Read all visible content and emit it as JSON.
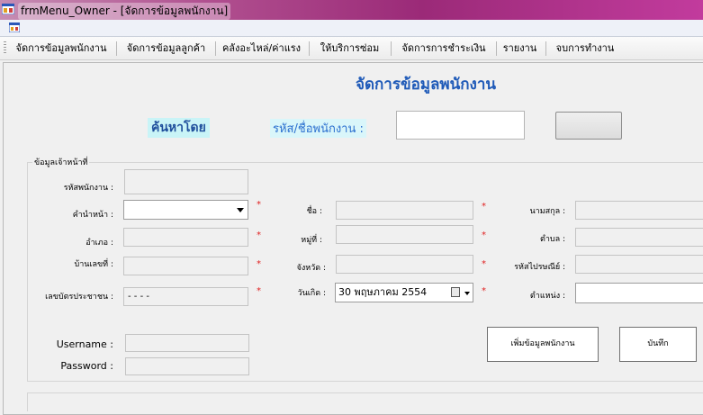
{
  "window": {
    "title": "frmMenu_Owner - [จัดการข้อมูลพนักงาน]"
  },
  "menu": {
    "items": [
      "จัดการข้อมูลพนักงาน",
      "จัดการข้อมูลลูกค้า",
      "คลังอะไหล่/ค่าแรง",
      "ให้บริการซ่อม",
      "จัดการการชำระเงิน",
      "รายงาน",
      "จบการทำงาน"
    ]
  },
  "form": {
    "heading": "จัดการข้อมูลพนักงาน",
    "search_label": "ค้นหาโดย",
    "search_sub": "รหัส/ชื่อพนักงาน :",
    "search_value": "",
    "search_button_label": "",
    "group_title": "ข้อมูลเจ้าหน้าที่",
    "labels": {
      "emp_id": "รหัสพนักงาน :",
      "prefix": "คำนำหน้า :",
      "first_name": "ชื่อ :",
      "last_name": "นามสกุล :",
      "district": "อำเภอ :",
      "village": "หมู่ที่ :",
      "subdistrict": "ตำบล :",
      "house_no": "บ้านเลขที่ :",
      "province": "จังหวัด :",
      "postcode": "รหัสไปรษณีย์ :",
      "id_card": "เลขบัตรประชาชน :",
      "birthdate": "วันเกิด :",
      "position": "ตำแหน่ง :",
      "username": "Username :",
      "password": "Password :"
    },
    "required_mark": "*",
    "id_card_mask": "-    -        -   -",
    "birthdate_value": "30  พฤษภาคม    2554",
    "add_button_label": "เพิ่มข้อมูลพนักงาน",
    "save_button_label": "บันทึก"
  }
}
